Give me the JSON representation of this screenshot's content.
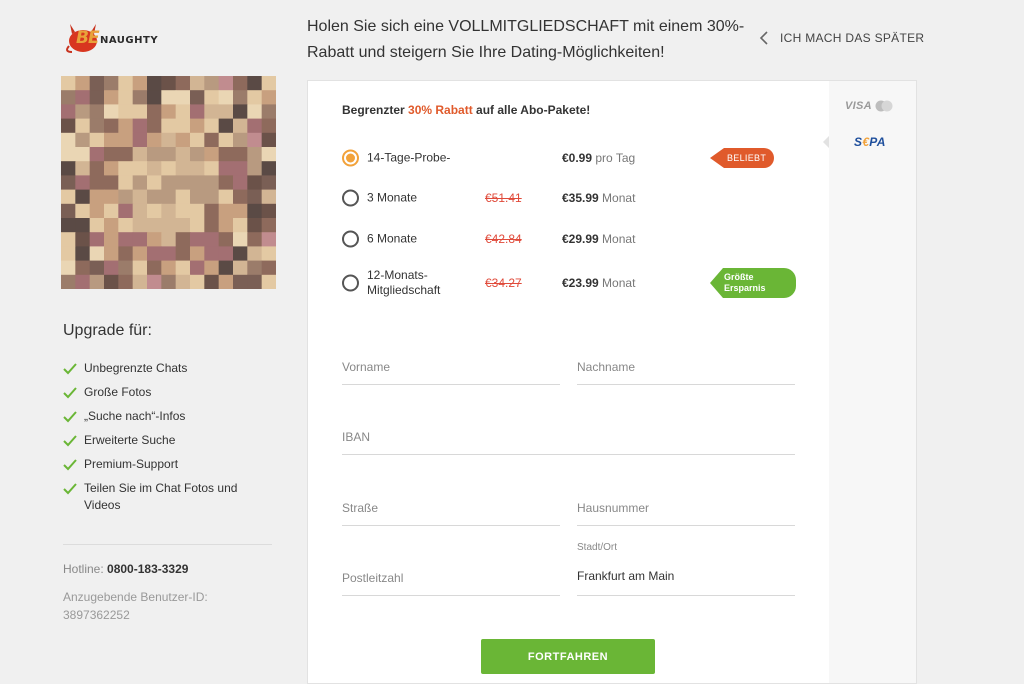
{
  "brand": {
    "be": "BE",
    "naughty": "NAUGHTY"
  },
  "header": {
    "headline": "Holen Sie sich eine VOLLMITGLIEDSCHAFT mit einem 30%-Rabatt und steigern Sie Ihre Dating-Möglichkeiten!",
    "later_label": "ICH MACH DAS SPÄTER"
  },
  "sidebar": {
    "upgrade_title": "Upgrade für:",
    "features": [
      "Unbegrenzte Chats",
      "Große Fotos",
      "„Suche nach“-Infos",
      "Erweiterte Suche",
      "Premium-Support",
      "Teilen Sie im Chat Fotos und Videos"
    ],
    "hotline_label": "Hotline:",
    "hotline_number": "0800-183-3329",
    "userid_label": "Anzugebende Benutzer-ID:",
    "userid_value": "3897362252"
  },
  "offer": {
    "promo_prefix": "Begrenzter ",
    "promo_accent": "30% Rabatt",
    "promo_suffix": " auf alle Abo-Pakete!",
    "plans": [
      {
        "name": "14-Tage-Probe-",
        "old_price": "",
        "price": "€0.99",
        "unit": "pro Tag",
        "badge": "BELIEBT",
        "selected": true
      },
      {
        "name": "3 Monate",
        "old_price": "€51.41",
        "price": "€35.99",
        "unit": "Monat",
        "badge": "",
        "selected": false
      },
      {
        "name": "6 Monate",
        "old_price": "€42.84",
        "price": "€29.99",
        "unit": "Monat",
        "badge": "",
        "selected": false
      },
      {
        "name": "12-Monats-Mitgliedschaft",
        "old_price": "€34.27",
        "price": "€23.99",
        "unit": "Monat",
        "badge": "Größte Ersparnis",
        "selected": false
      }
    ]
  },
  "form": {
    "first_name_placeholder": "Vorname",
    "last_name_placeholder": "Nachname",
    "iban_placeholder": "IBAN",
    "street_placeholder": "Straße",
    "house_number_placeholder": "Hausnummer",
    "postal_code_placeholder": "Postleitzahl",
    "city_label": "Stadt/Ort",
    "city_value": "Frankfurt am Main",
    "submit_label": "FORTFAHREN"
  },
  "payment": {
    "visa_label": "VISA",
    "sepa_s": "S",
    "sepa_e": "€",
    "sepa_pa": "PA"
  },
  "colors": {
    "accent_orange": "#e05a2b",
    "radio_selected": "#f2a23a",
    "green": "#6ab636",
    "strike_red": "#e04a3a"
  },
  "icons": [
    "devil-logo-icon",
    "chevron-left-icon",
    "check-icon",
    "mastercard-icon"
  ]
}
